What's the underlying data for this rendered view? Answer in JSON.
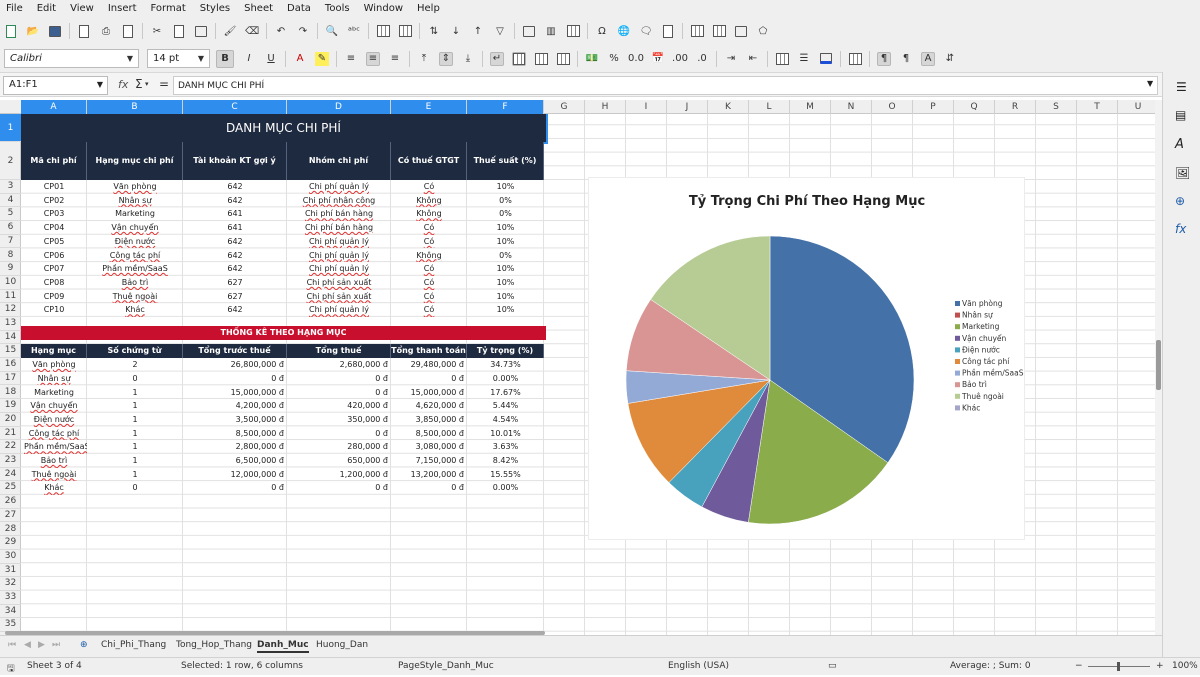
{
  "menu": [
    "File",
    "Edit",
    "View",
    "Insert",
    "Format",
    "Styles",
    "Sheet",
    "Data",
    "Tools",
    "Window",
    "Help"
  ],
  "font": {
    "name": "Calibri",
    "size": "14 pt"
  },
  "namebox": "A1:F1",
  "formula": "DANH MỤC CHI PHÍ",
  "columns": [
    "A",
    "B",
    "C",
    "D",
    "E",
    "F",
    "G",
    "H",
    "I",
    "J",
    "K",
    "L",
    "M",
    "N",
    "O",
    "P",
    "Q",
    "R",
    "S",
    "T",
    "U"
  ],
  "rows": [
    "1",
    "2",
    "3",
    "4",
    "5",
    "6",
    "7",
    "8",
    "9",
    "10",
    "11",
    "12",
    "13",
    "14",
    "15",
    "16",
    "17",
    "18",
    "19",
    "20",
    "21",
    "22",
    "23",
    "24",
    "25",
    "26",
    "27",
    "28",
    "29",
    "30",
    "31",
    "32",
    "33",
    "34",
    "35"
  ],
  "title": "DANH MỤC CHI PHÍ",
  "table1": {
    "headers": [
      "Mã chi phí",
      "Hạng mục chi phí",
      "Tài khoản KT gợi ý",
      "Nhóm chi phí",
      "Có thuế GTGT",
      "Thuế suất (%)"
    ],
    "rows": [
      [
        "CP01",
        "Văn phòng",
        "642",
        "Chi phí quản lý",
        "Có",
        "10%"
      ],
      [
        "CP02",
        "Nhân sự",
        "642",
        "Chi phí nhân công",
        "Không",
        "0%"
      ],
      [
        "CP03",
        "Marketing",
        "641",
        "Chi phí bán hàng",
        "Không",
        "0%"
      ],
      [
        "CP04",
        "Vận chuyển",
        "641",
        "Chi phí bán hàng",
        "Có",
        "10%"
      ],
      [
        "CP05",
        "Điện nước",
        "642",
        "Chi phí quản lý",
        "Có",
        "10%"
      ],
      [
        "CP06",
        "Công tác phí",
        "642",
        "Chi phí quản lý",
        "Không",
        "0%"
      ],
      [
        "CP07",
        "Phần mềm/SaaS",
        "642",
        "Chi phí quản lý",
        "Có",
        "10%"
      ],
      [
        "CP08",
        "Bảo trì",
        "627",
        "Chi phí sản xuất",
        "Có",
        "10%"
      ],
      [
        "CP09",
        "Thuê ngoài",
        "627",
        "Chi phí sản xuất",
        "Có",
        "10%"
      ],
      [
        "CP10",
        "Khác",
        "642",
        "Chi phí quản lý",
        "Có",
        "10%"
      ]
    ]
  },
  "stats_title": "THỐNG KÊ THEO HẠNG MỤC",
  "table2": {
    "headers": [
      "Hạng mục",
      "Số chứng từ",
      "Tổng trước thuế",
      "Tổng thuế",
      "Tổng thanh toán",
      "Tỷ trọng (%)"
    ],
    "rows": [
      [
        "Văn phòng",
        "2",
        "26,800,000 đ",
        "2,680,000 đ",
        "29,480,000 đ",
        "34.73%"
      ],
      [
        "Nhân sự",
        "0",
        "0 đ",
        "0 đ",
        "0 đ",
        "0.00%"
      ],
      [
        "Marketing",
        "1",
        "15,000,000 đ",
        "0 đ",
        "15,000,000 đ",
        "17.67%"
      ],
      [
        "Vận chuyển",
        "1",
        "4,200,000 đ",
        "420,000 đ",
        "4,620,000 đ",
        "5.44%"
      ],
      [
        "Điện nước",
        "1",
        "3,500,000 đ",
        "350,000 đ",
        "3,850,000 đ",
        "4.54%"
      ],
      [
        "Công tác phí",
        "1",
        "8,500,000 đ",
        "0 đ",
        "8,500,000 đ",
        "10.01%"
      ],
      [
        "Phần mềm/SaaS",
        "1",
        "2,800,000 đ",
        "280,000 đ",
        "3,080,000 đ",
        "3.63%"
      ],
      [
        "Bảo trì",
        "1",
        "6,500,000 đ",
        "650,000 đ",
        "7,150,000 đ",
        "8.42%"
      ],
      [
        "Thuê ngoài",
        "1",
        "12,000,000 đ",
        "1,200,000 đ",
        "13,200,000 đ",
        "15.55%"
      ],
      [
        "Khác",
        "0",
        "0 đ",
        "0 đ",
        "0 đ",
        "0.00%"
      ]
    ]
  },
  "chart_data": {
    "type": "pie",
    "title": "Tỷ Trọng Chi Phí Theo Hạng Mục",
    "legend_position": "right",
    "categories": [
      "Văn phòng",
      "Nhân sự",
      "Marketing",
      "Vận chuyển",
      "Điện nước",
      "Công tác phí",
      "Phần mềm/SaaS",
      "Bảo trì",
      "Thuê ngoài",
      "Khác"
    ],
    "values": [
      34.73,
      0.0,
      17.67,
      5.44,
      4.54,
      10.01,
      3.63,
      8.42,
      15.55,
      0.0
    ],
    "colors": [
      "#4472a8",
      "#c0504d",
      "#8aac4b",
      "#6f5a9b",
      "#48a1bd",
      "#e08a3c",
      "#93a9d6",
      "#d99594",
      "#b7cc94",
      "#a5a5c9"
    ]
  },
  "sheet_tabs": [
    "Chi_Phi_Thang",
    "Tong_Hop_Thang",
    "Danh_Muc",
    "Huong_Dan"
  ],
  "active_tab": "Danh_Muc",
  "status": {
    "sheet": "Sheet 3 of 4",
    "selection": "Selected: 1 row, 6 columns",
    "page_style": "PageStyle_Danh_Muc",
    "language": "English (USA)",
    "summary": "Average: ; Sum: 0",
    "zoom": "100%"
  }
}
